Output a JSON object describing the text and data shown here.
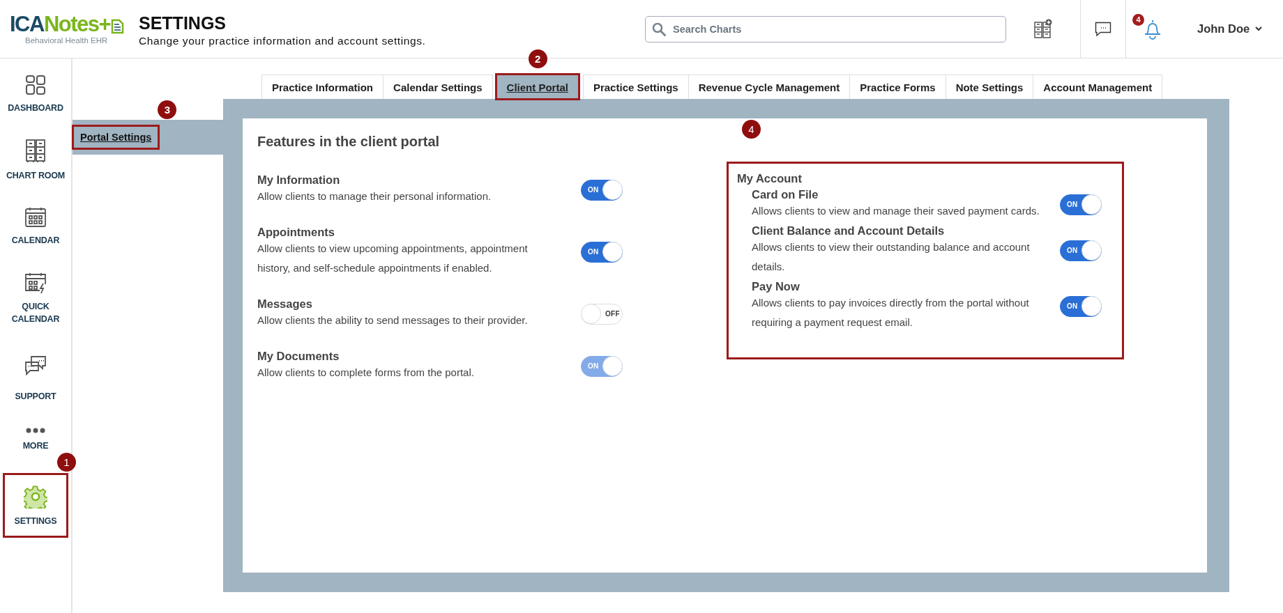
{
  "header": {
    "logo": {
      "primary": "ICA",
      "secondary": "Notes+",
      "tagline": "Behavioral Health EHR"
    },
    "title": "SETTINGS",
    "subtitle": "Change your practice information and account settings.",
    "search": {
      "placeholder": "Search Charts"
    },
    "notification_count": "4",
    "user": {
      "name": "John Doe"
    }
  },
  "nav": [
    {
      "kind": "dashboard",
      "label": "DASHBOARD",
      "highlighted": false
    },
    {
      "kind": "chart_room",
      "label": "CHART ROOM",
      "highlighted": false
    },
    {
      "kind": "calendar",
      "label": "CALENDAR",
      "highlighted": false
    },
    {
      "kind": "quick_calendar",
      "label": "QUICK CALENDAR",
      "highlighted": false
    },
    {
      "kind": "support",
      "label": "SUPPORT",
      "highlighted": false
    },
    {
      "kind": "more",
      "label": "MORE",
      "highlighted": false
    },
    {
      "kind": "settings",
      "label": "SETTINGS",
      "highlighted": true,
      "callout": "1"
    }
  ],
  "tabs": [
    {
      "label": "Practice Information",
      "selected": false,
      "highlighted": false
    },
    {
      "label": "Calendar Settings",
      "selected": false,
      "highlighted": false
    },
    {
      "label": "Client Portal",
      "selected": true,
      "highlighted": true,
      "callout": "2"
    },
    {
      "label": "Practice Settings",
      "selected": false,
      "highlighted": false
    },
    {
      "label": "Revenue Cycle Management",
      "selected": false,
      "highlighted": false
    },
    {
      "label": "Practice Forms",
      "selected": false,
      "highlighted": false
    },
    {
      "label": "Note Settings",
      "selected": false,
      "highlighted": false
    },
    {
      "label": "Account Management",
      "selected": false,
      "highlighted": false
    }
  ],
  "subnav": [
    {
      "label": "Portal Settings",
      "selected": true,
      "highlighted": true,
      "callout": "3"
    }
  ],
  "panel": {
    "title": "Features in the client portal",
    "features": [
      {
        "title": "My Information",
        "description": "Allow clients to manage their personal information.",
        "on": true,
        "disabled": false,
        "state_label": "ON"
      },
      {
        "title": "Appointments",
        "description": "Allow clients to view upcoming appointments, appointment history, and self-schedule appointments if enabled.",
        "on": true,
        "disabled": false,
        "state_label": "ON"
      },
      {
        "title": "Messages",
        "description": "Allow clients the ability to send messages to their provider.",
        "on": false,
        "disabled": false,
        "state_label": "OFF"
      },
      {
        "title": "My Documents",
        "description": "Allow clients to complete forms from the portal.",
        "on": true,
        "disabled": true,
        "state_label": "ON"
      }
    ],
    "account_group": {
      "title": "My Account",
      "highlighted": true,
      "callout": "4",
      "features": [
        {
          "title": "Card on File",
          "description": "Allows clients to view and manage their saved payment cards.",
          "on": true,
          "disabled": false,
          "state_label": "ON"
        },
        {
          "title": "Client Balance and Account Details",
          "description": "Allows clients to view their outstanding balance and account details.",
          "on": true,
          "disabled": false,
          "state_label": "ON"
        },
        {
          "title": "Pay Now",
          "description": "Allows clients to pay invoices directly from the portal without requiring a payment request email.",
          "on": true,
          "disabled": false,
          "state_label": "ON"
        }
      ]
    }
  }
}
